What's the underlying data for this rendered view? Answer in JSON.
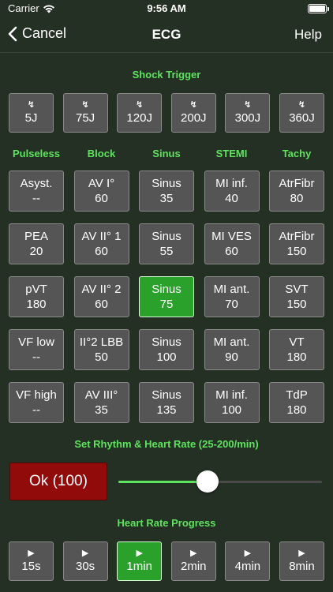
{
  "status": {
    "carrier": "Carrier",
    "time": "9:56 AM"
  },
  "nav": {
    "back_label": "Cancel",
    "title": "ECG",
    "help_label": "Help"
  },
  "shock": {
    "title": "Shock Trigger",
    "icon_glyph": "↯",
    "buttons": [
      "5J",
      "75J",
      "120J",
      "200J",
      "300J",
      "360J"
    ]
  },
  "rhythm": {
    "columns": [
      "Pulseless",
      "Block",
      "Sinus",
      "STEMI",
      "Tachy"
    ],
    "rows": [
      [
        {
          "name": "Asyst.",
          "rate": "--"
        },
        {
          "name": "AV I°",
          "rate": "60"
        },
        {
          "name": "Sinus",
          "rate": "35"
        },
        {
          "name": "MI inf.",
          "rate": "40"
        },
        {
          "name": "AtrFibr",
          "rate": "80"
        }
      ],
      [
        {
          "name": "PEA",
          "rate": "20"
        },
        {
          "name": "AV II° 1",
          "rate": "60"
        },
        {
          "name": "Sinus",
          "rate": "55"
        },
        {
          "name": "MI VES",
          "rate": "60"
        },
        {
          "name": "AtrFibr",
          "rate": "150"
        }
      ],
      [
        {
          "name": "pVT",
          "rate": "180"
        },
        {
          "name": "AV II° 2",
          "rate": "60"
        },
        {
          "name": "Sinus",
          "rate": "75"
        },
        {
          "name": "MI ant.",
          "rate": "70"
        },
        {
          "name": "SVT",
          "rate": "150"
        }
      ],
      [
        {
          "name": "VF low",
          "rate": "--"
        },
        {
          "name": "II°2 LBB",
          "rate": "50"
        },
        {
          "name": "Sinus",
          "rate": "100"
        },
        {
          "name": "MI ant.",
          "rate": "90"
        },
        {
          "name": "VT",
          "rate": "180"
        }
      ],
      [
        {
          "name": "VF high",
          "rate": "--"
        },
        {
          "name": "AV III°",
          "rate": "35"
        },
        {
          "name": "Sinus",
          "rate": "135"
        },
        {
          "name": "MI inf.",
          "rate": "100"
        },
        {
          "name": "TdP",
          "rate": "180"
        }
      ]
    ],
    "selected": {
      "row": 2,
      "col": 2
    }
  },
  "heart_rate": {
    "title": "Set Rhythm & Heart Rate (25-200/min)",
    "ok_label": "Ok (100)",
    "min": 25,
    "max": 200,
    "value": 100
  },
  "progress": {
    "title": "Heart Rate Progress",
    "play_glyph": "▶",
    "buttons": [
      "15s",
      "30s",
      "1min",
      "2min",
      "4min",
      "8min"
    ],
    "selected": 2
  },
  "colors": {
    "accent_green": "#5ee35e",
    "active_green": "#2aa12a",
    "ok_red": "#920b0b",
    "background": "#243024",
    "button_gray": "#555555"
  }
}
